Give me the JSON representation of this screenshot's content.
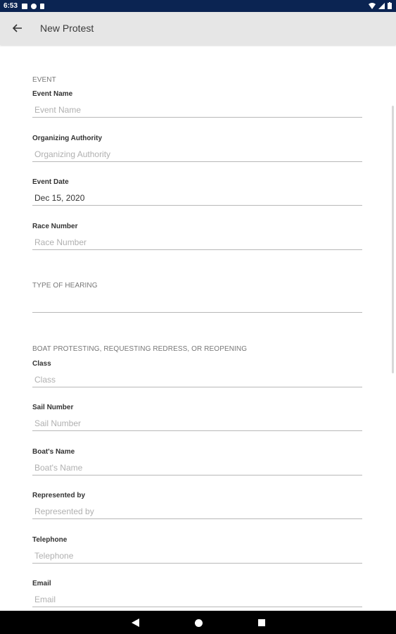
{
  "status_bar": {
    "time": "6:53"
  },
  "header": {
    "title": "New Protest"
  },
  "sections": {
    "event": "EVENT",
    "type_of_hearing": "TYPE OF HEARING",
    "boat_protesting": "BOAT PROTESTING, REQUESTING REDRESS, OR REOPENING"
  },
  "fields": {
    "event_name": {
      "label": "Event Name",
      "placeholder": "Event Name",
      "value": ""
    },
    "organizing_authority": {
      "label": "Organizing Authority",
      "placeholder": "Organizing Authority",
      "value": ""
    },
    "event_date": {
      "label": "Event Date",
      "placeholder": "",
      "value": "Dec 15, 2020"
    },
    "race_number": {
      "label": "Race Number",
      "placeholder": "Race Number",
      "value": ""
    },
    "type_of_hearing": {
      "placeholder": "",
      "value": ""
    },
    "class": {
      "label": "Class",
      "placeholder": "Class",
      "value": ""
    },
    "sail_number": {
      "label": "Sail Number",
      "placeholder": "Sail Number",
      "value": ""
    },
    "boats_name": {
      "label": "Boat's Name",
      "placeholder": "Boat's Name",
      "value": ""
    },
    "represented_by": {
      "label": "Represented by",
      "placeholder": "Represented by",
      "value": ""
    },
    "telephone": {
      "label": "Telephone",
      "placeholder": "Telephone",
      "value": ""
    },
    "email": {
      "label": "Email",
      "placeholder": "Email",
      "value": ""
    }
  },
  "colors": {
    "status_bar": "#0b2452",
    "app_bar": "#e6e6e6",
    "nav_bar": "#000000"
  },
  "icons": {
    "back": "arrow-left-icon",
    "nav_back": "triangle-back-icon",
    "nav_home": "circle-home-icon",
    "nav_recents": "square-recents-icon"
  }
}
